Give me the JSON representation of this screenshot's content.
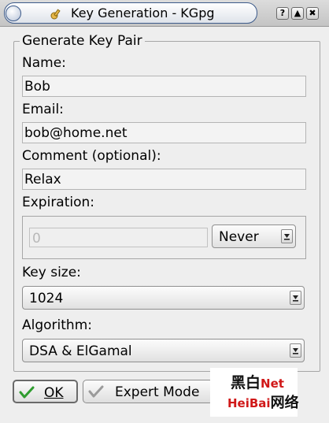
{
  "window": {
    "title": "Key Generation - KGpg",
    "buttons": {
      "help": "?",
      "minimize": "▲",
      "close": "✖"
    }
  },
  "group": {
    "title": "Generate Key Pair"
  },
  "name": {
    "label": "Name:",
    "value": "Bob"
  },
  "email": {
    "label": "Email:",
    "value": "bob@home.net"
  },
  "comment": {
    "label": "Comment (optional):",
    "value": "Relax"
  },
  "expiration": {
    "label": "Expiration:",
    "number_value": "0",
    "unit_selected": "Never",
    "enabled_number": false
  },
  "key_size": {
    "label": "Key size:",
    "selected": "1024"
  },
  "algorithm": {
    "label": "Algorithm:",
    "selected": "DSA & ElGamal"
  },
  "footer": {
    "ok_label": "OK",
    "expert_label": "Expert Mode"
  },
  "watermark": {
    "line1_cn": "黑白",
    "line1_net": "Net",
    "line2_latin": "HeiBai",
    "line2_cn": "网络"
  },
  "icons": {
    "app": "kgpg-key-icon",
    "ok": "checkmark-icon",
    "expert": "checkmark-outline-icon",
    "combo_arrow": "chevron-down-icon"
  },
  "colors": {
    "background": "#eeeeee",
    "titlebar_border": "#3c5a8a",
    "ok_check": "#2f9c2f",
    "watermark_red": "#d01818"
  }
}
